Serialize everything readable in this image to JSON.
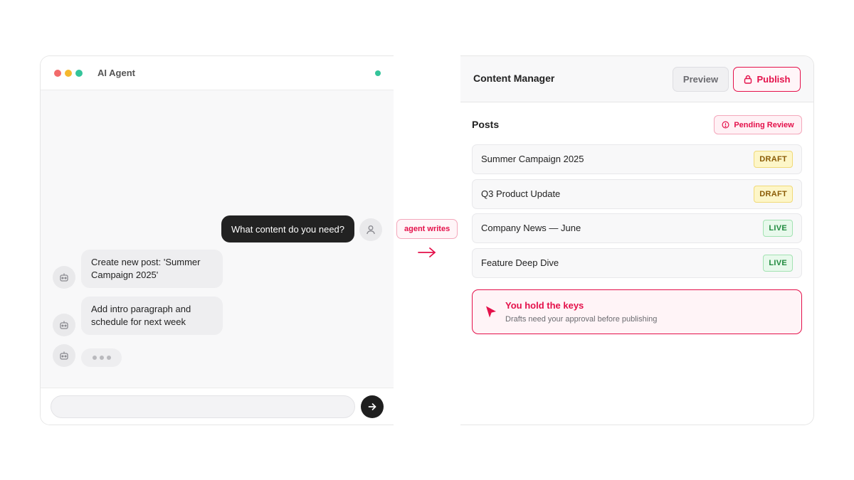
{
  "chat": {
    "title": "AI Agent",
    "window_controls": [
      {
        "name": "close",
        "color": "#f26b6b"
      },
      {
        "name": "minimize",
        "color": "#f5b82e"
      },
      {
        "name": "maximize",
        "color": "#34c49a"
      }
    ],
    "status_color": "#34c49a",
    "messages": [
      {
        "role": "user",
        "text": "What content do you need?"
      },
      {
        "role": "agent",
        "text": "Create new post: 'Summer Campaign 2025'"
      },
      {
        "role": "agent",
        "text": "Add intro paragraph and schedule for next week"
      }
    ],
    "typing_indicator": true,
    "input": {
      "value": "",
      "placeholder": ""
    },
    "send_icon": "arrow-right-icon"
  },
  "connector": {
    "label": "agent writes",
    "icon": "arrow-right-icon"
  },
  "cms": {
    "title": "Content Manager",
    "preview_label": "Preview",
    "publish_label": "Publish",
    "publish_icon": "lock-icon",
    "posts_title": "Posts",
    "pending_badge": "Pending Review",
    "pending_icon": "alert-circle-icon",
    "posts": [
      {
        "title": "Summer Campaign 2025",
        "status": "DRAFT"
      },
      {
        "title": "Q3 Product Update",
        "status": "DRAFT"
      },
      {
        "title": "Company News — June",
        "status": "LIVE"
      },
      {
        "title": "Feature Deep Dive",
        "status": "LIVE"
      }
    ],
    "notice": {
      "icon": "cursor-pointer-icon",
      "title": "You hold the keys",
      "subtitle": "Drafts need your approval before publishing"
    }
  },
  "colors": {
    "accent": "#e4104a",
    "user_bubble": "#222222",
    "draft": "#8a5b06",
    "live": "#1f8a3e"
  }
}
